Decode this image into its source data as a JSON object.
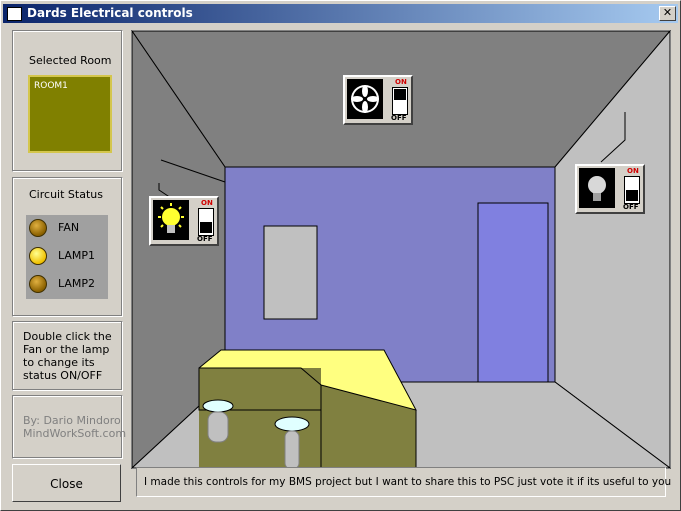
{
  "window": {
    "title": "Dards Electrical controls",
    "close_glyph": "✕"
  },
  "selected_room": {
    "label": "Selected Room",
    "value": "ROOM1"
  },
  "circuit_status": {
    "label": "Circuit Status",
    "items": [
      {
        "name": "FAN",
        "state": "off"
      },
      {
        "name": "LAMP1",
        "state": "on"
      },
      {
        "name": "LAMP2",
        "state": "off"
      }
    ]
  },
  "help": {
    "text": "Double click the Fan or the lamp to change its status ON/OFF"
  },
  "author": {
    "line1": "By: Dario Mindoro",
    "line2": "MindWorkSoft.com"
  },
  "buttons": {
    "close": "Close"
  },
  "statusbar": {
    "text": "I made this controls for my BMS project but I want to share this to PSC just vote it if its useful to you"
  },
  "devices": {
    "fan": {
      "icon": "fan-icon",
      "switch_on": "ON",
      "switch_off": "OFF",
      "state": "off"
    },
    "lamp1": {
      "icon": "bulb-on-icon",
      "switch_on": "ON",
      "switch_off": "OFF",
      "state": "on"
    },
    "lamp2": {
      "icon": "bulb-off-icon",
      "switch_on": "ON",
      "switch_off": "OFF",
      "state": "off"
    }
  },
  "colors": {
    "title_gradient_start": "#0a246a",
    "room_box": "#808000",
    "back_wall": "#8080c8",
    "door": "#8080e0",
    "desk_top": "#ffff80",
    "desk_side": "#808040"
  }
}
